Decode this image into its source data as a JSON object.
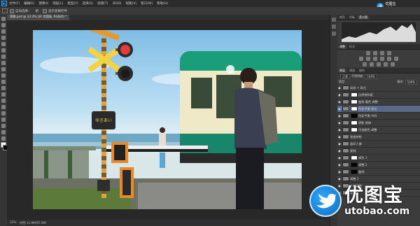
{
  "app": {
    "logo": "Ps"
  },
  "menu": {
    "items": [
      "文件(F)",
      "编辑(E)",
      "图像(I)",
      "图层(L)",
      "类型(Y)",
      "选择(S)",
      "滤镜(T)",
      "3D(D)",
      "视图(V)",
      "窗口(W)",
      "帮助(H)"
    ]
  },
  "options": {
    "auto_select_label": "自动选择：",
    "auto_select_target": "组",
    "show_transform": "显示变换控件"
  },
  "brand": {
    "icon_text": "优",
    "line1": "优图宝",
    "line2": "utobao.com"
  },
  "document": {
    "tab_title": "铁路.psd @ 33.3% (开 文图层, RGB/8) *"
  },
  "status": {
    "zoom": "33%",
    "doc_size": "文档:11.9M/97.6M"
  },
  "panels": {
    "top_tabs": [
      "颜色",
      "色板",
      "直方图"
    ],
    "adj_tabs": [
      "调整",
      "样式"
    ],
    "layer_tabs": [
      "图层",
      "通道",
      "路径"
    ],
    "blend_mode": "正常",
    "opacity_label": "不透明度:",
    "opacity_value": "100%",
    "lock_label": "锁定:",
    "fill_label": "填充:",
    "fill_value": "100%"
  },
  "layers": [
    {
      "name": "局部 + 高光"
    },
    {
      "name": "自然饱和度"
    },
    {
      "name": "曲线 暖色 调整"
    },
    {
      "name": "色彩平衡 高光"
    },
    {
      "name": "色彩平衡 中间"
    },
    {
      "name": "阴影 饱和"
    },
    {
      "name": "可选颜色 调整"
    },
    {
      "name": "渐变映射"
    },
    {
      "name": "盖印人像"
    },
    {
      "name": "复制"
    },
    {
      "name": "调色 1"
    },
    {
      "name": "调整 2"
    },
    {
      "name": "曲线"
    },
    {
      "name": "调整 2"
    },
    {
      "name": "人物调整"
    },
    {
      "name": "背景"
    }
  ],
  "photo": {
    "crossing_sign": "ゆきあい"
  },
  "colors": {
    "bg": "#282828",
    "panel": "#3c3c3c",
    "accent": "#1d8ee6",
    "train_green": "#1a9e7a",
    "train_cream": "#efe9c8"
  }
}
